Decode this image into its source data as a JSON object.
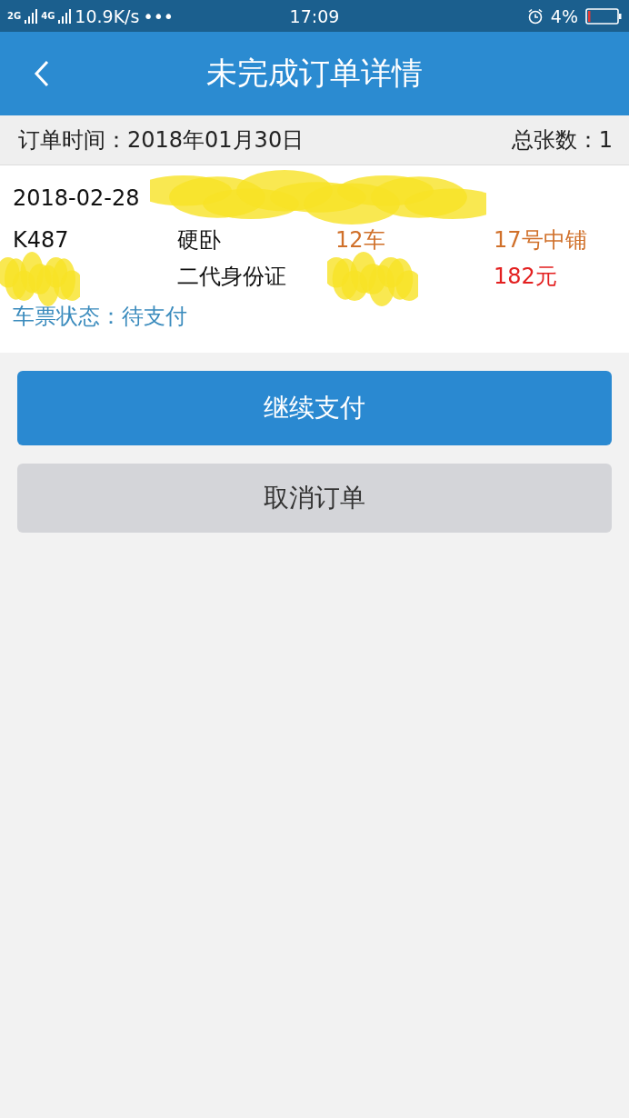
{
  "status_bar": {
    "network_left": "2G",
    "network_right": "4G",
    "speed": "10.9K/s",
    "more": "•••",
    "time": "17:09",
    "battery": "4%"
  },
  "header": {
    "title": "未完成订单详情"
  },
  "summary": {
    "order_time": "订单时间：2018年01月30日",
    "ticket_count": "总张数：1"
  },
  "ticket": {
    "date": "2018-02-28",
    "train": "K487",
    "seat_type": "硬卧",
    "coach": "12车",
    "seat": "17号中铺",
    "id_type": "二代身份证",
    "price": "182元",
    "status": "车票状态：待支付"
  },
  "buttons": [
    {
      "label": "继续支付",
      "kind": "primary"
    },
    {
      "label": "取消订单",
      "kind": "secondary"
    }
  ]
}
